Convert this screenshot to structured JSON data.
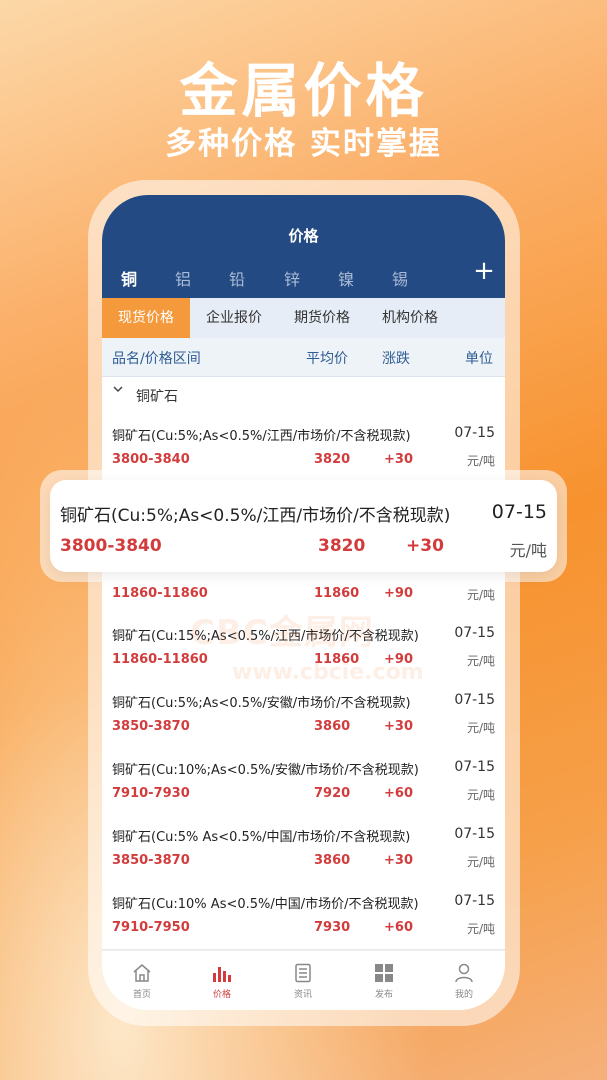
{
  "promo": {
    "title": "金属价格",
    "subtitle": "多种价格 实时掌握"
  },
  "header": {
    "title": "价格"
  },
  "metals": [
    "铜",
    "铝",
    "铅",
    "锌",
    "镍",
    "锡"
  ],
  "price_tabs": [
    "现货价格",
    "企业报价",
    "期货价格",
    "机构价格"
  ],
  "columns": {
    "name": "品名/价格区间",
    "avg": "平均价",
    "change": "涨跌",
    "unit": "单位"
  },
  "category": "铜矿石",
  "rows": [
    {
      "name": "铜矿石(Cu:5%;As<0.5%/江西/市场价/不含税现款)",
      "date": "07-15",
      "range": "3800-3840",
      "avg": "3820",
      "change": "+30",
      "unit": "元/吨"
    },
    {
      "name": "",
      "date": "",
      "range": "11860-11860",
      "avg": "11860",
      "change": "+90",
      "unit": "元/吨"
    },
    {
      "name": "铜矿石(Cu:15%;As<0.5%/江西/市场价/不含税现款)",
      "date": "07-15",
      "range": "11860-11860",
      "avg": "11860",
      "change": "+90",
      "unit": "元/吨"
    },
    {
      "name": "铜矿石(Cu:5%;As<0.5%/安徽/市场价/不含税现款)",
      "date": "07-15",
      "range": "3850-3870",
      "avg": "3860",
      "change": "+30",
      "unit": "元/吨"
    },
    {
      "name": "铜矿石(Cu:10%;As<0.5%/安徽/市场价/不含税现款)",
      "date": "07-15",
      "range": "7910-7930",
      "avg": "7920",
      "change": "+60",
      "unit": "元/吨"
    },
    {
      "name": "铜矿石(Cu:5% As<0.5%/中国/市场价/不含税现款)",
      "date": "07-15",
      "range": "3850-3870",
      "avg": "3860",
      "change": "+30",
      "unit": "元/吨"
    },
    {
      "name": "铜矿石(Cu:10% As<0.5%/中国/市场价/不含税现款)",
      "date": "07-15",
      "range": "7910-7950",
      "avg": "7930",
      "change": "+60",
      "unit": "元/吨"
    }
  ],
  "highlight": {
    "name": "铜矿石(Cu:5%;As<0.5%/江西/市场价/不含税现款)",
    "date": "07-15",
    "range": "3800-3840",
    "avg": "3820",
    "change": "+30",
    "unit": "元/吨"
  },
  "watermark": {
    "line1": "CBC金属网",
    "line2": "www.cbcie.com"
  },
  "bottom_nav": [
    {
      "label": "首页",
      "icon": "home-icon"
    },
    {
      "label": "价格",
      "icon": "bar-chart-icon"
    },
    {
      "label": "资讯",
      "icon": "news-icon"
    },
    {
      "label": "发布",
      "icon": "grid-icon"
    },
    {
      "label": "我的",
      "icon": "user-icon"
    }
  ],
  "colors": {
    "navy": "#234a82",
    "orange": "#f59a3c",
    "red": "#d23c3c"
  }
}
